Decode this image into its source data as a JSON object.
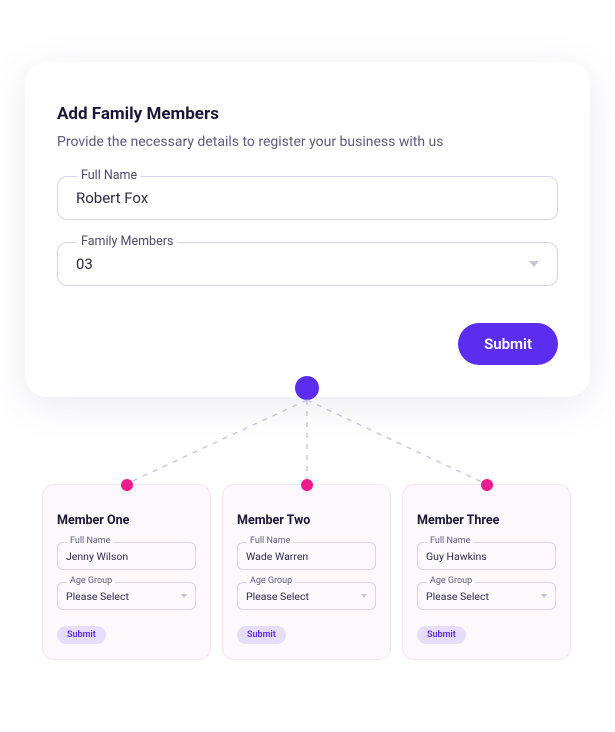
{
  "main": {
    "title": "Add Family Members",
    "subtitle": "Provide the necessary details to register your business with us",
    "full_name_label": "Full Name",
    "full_name_value": "Robert Fox",
    "family_members_label": "Family Members",
    "family_members_value": "03",
    "submit_label": "Submit"
  },
  "members": [
    {
      "title": "Member One",
      "full_name_label": "Full Name",
      "full_name_value": "Jenny Wilson",
      "age_group_label": "Age Group",
      "age_group_value": "Please Select",
      "submit_label": "Submit"
    },
    {
      "title": "Member Two",
      "full_name_label": "Full Name",
      "full_name_value": "Wade Warren",
      "age_group_label": "Age Group",
      "age_group_value": "Please Select",
      "submit_label": "Submit"
    },
    {
      "title": "Member Three",
      "full_name_label": "Full Name",
      "full_name_value": "Guy Hawkins",
      "age_group_label": "Age Group",
      "age_group_value": "Please Select",
      "submit_label": "Submit"
    }
  ]
}
